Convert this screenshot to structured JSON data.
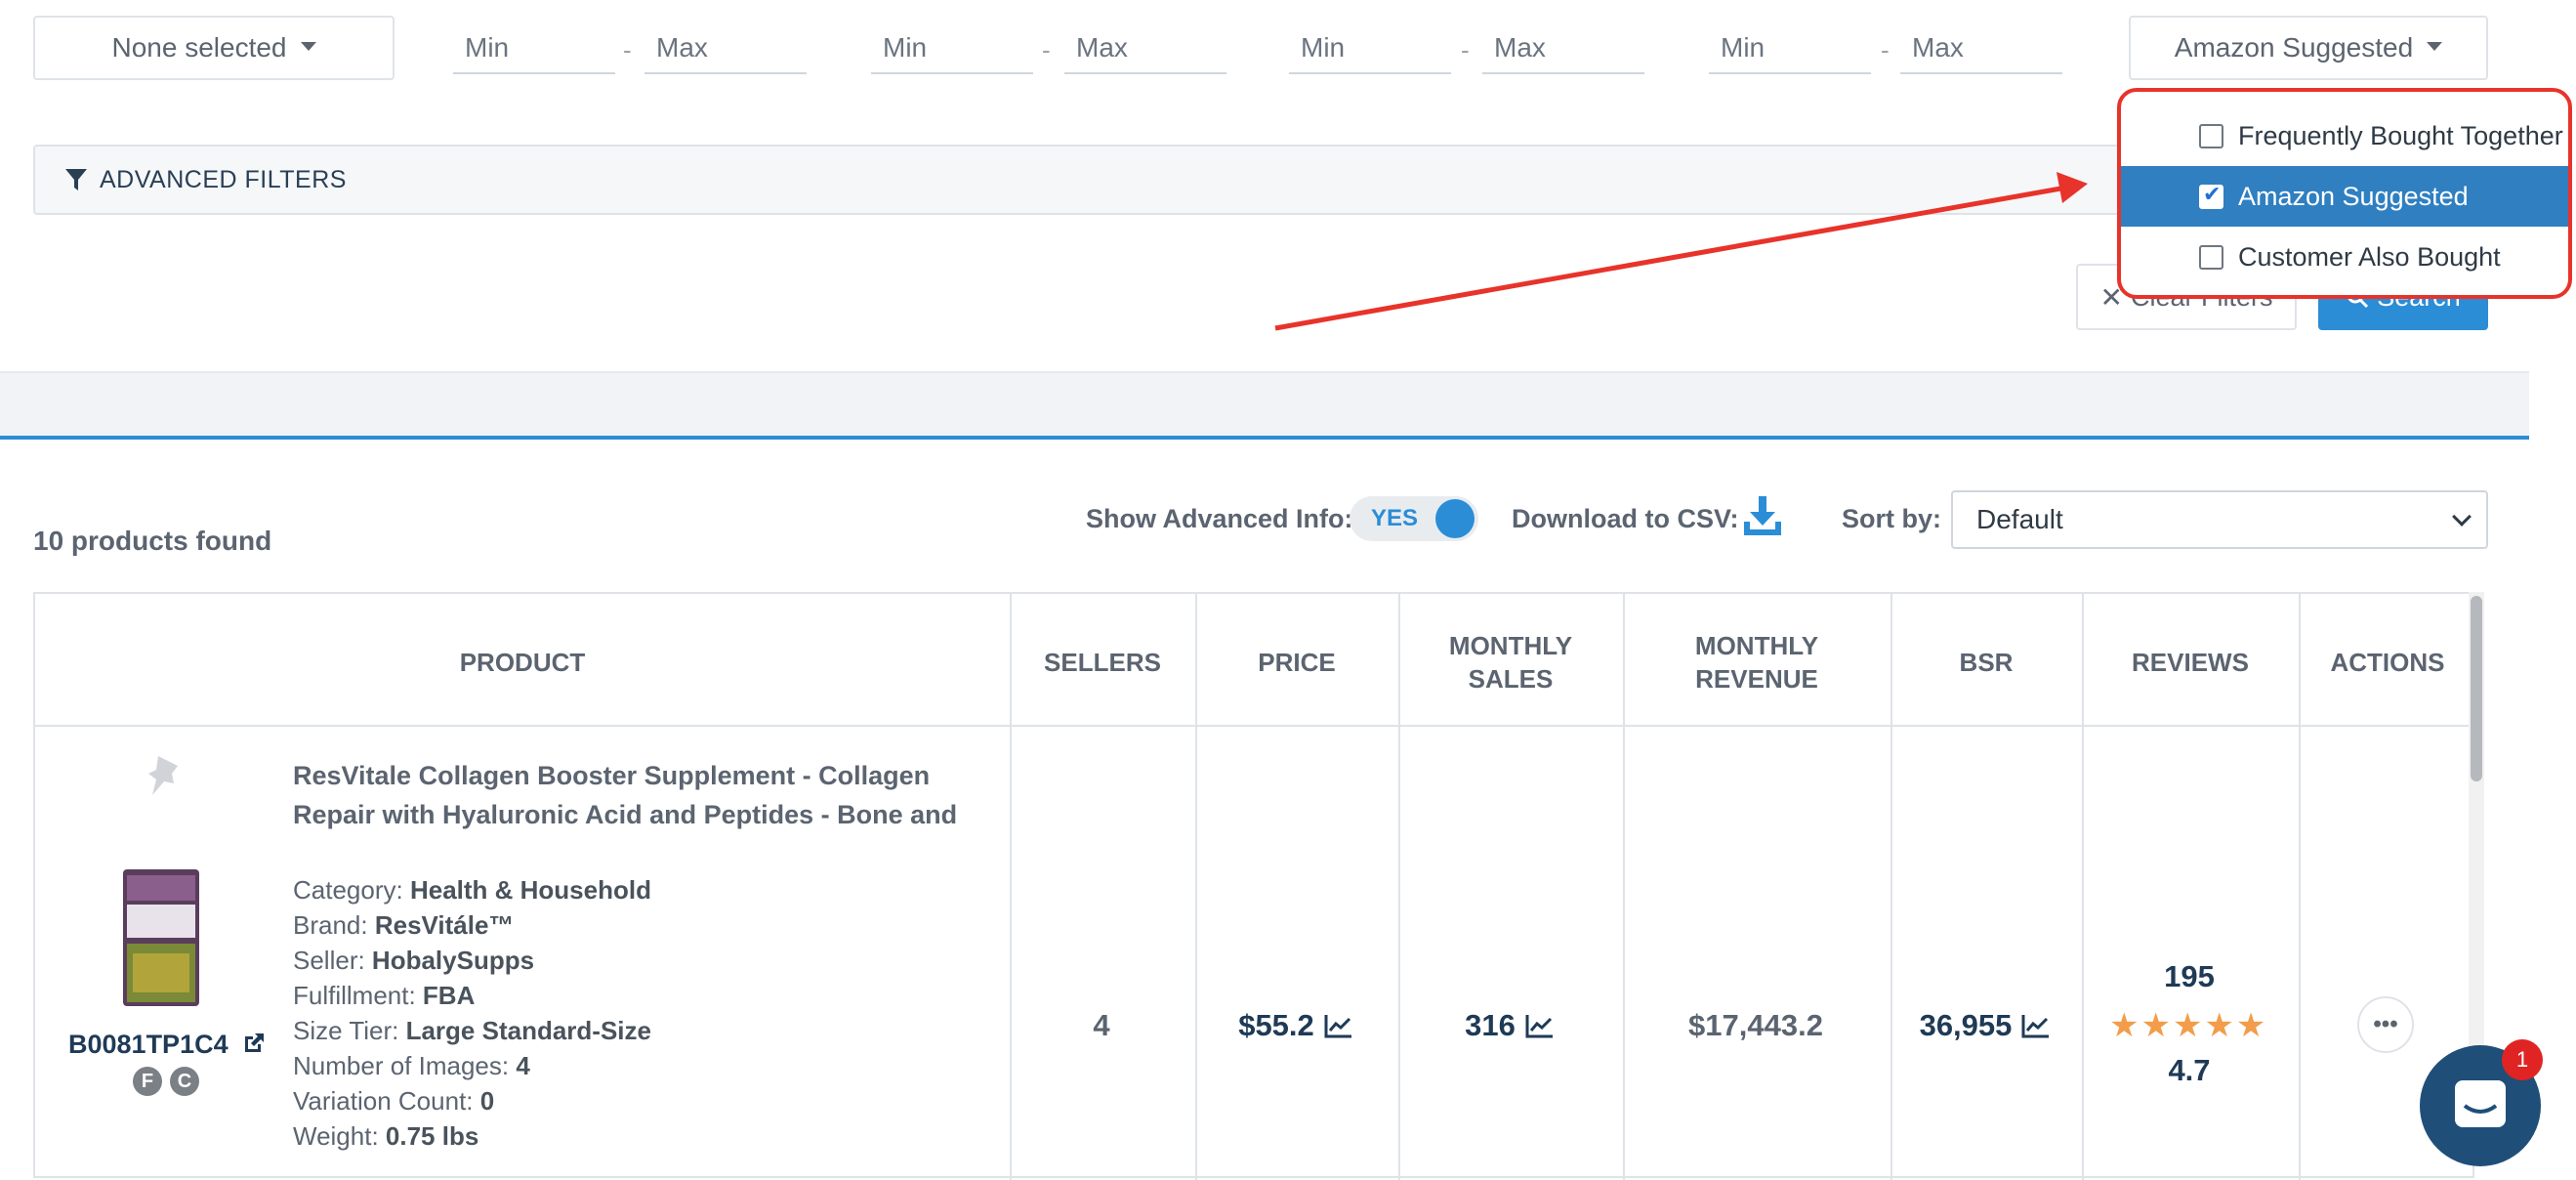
{
  "filters": {
    "none_selected": "None selected",
    "ranges": [
      {
        "min": "Min",
        "max": "Max"
      },
      {
        "min": "Min",
        "max": "Max"
      },
      {
        "min": "Min",
        "max": "Max"
      },
      {
        "min": "Min",
        "max": "Max"
      }
    ],
    "dash": "-",
    "relation_select": "Amazon Suggested",
    "advanced_filters": "ADVANCED FILTERS",
    "clear_filters": "Clear Filters",
    "search": "Search"
  },
  "dropdown": {
    "options": [
      {
        "label": "Frequently Bought Together",
        "checked": false
      },
      {
        "label": "Amazon Suggested",
        "checked": true
      },
      {
        "label": "Customer Also Bought",
        "checked": false
      }
    ]
  },
  "results": {
    "found": "10 products found",
    "show_advanced_label": "Show Advanced Info:",
    "toggle_value": "YES",
    "download_label": "Download to CSV:",
    "sort_label": "Sort by:",
    "sort_value": "Default"
  },
  "table": {
    "headers": {
      "product": "PRODUCT",
      "sellers": "SELLERS",
      "price": "PRICE",
      "monthly_sales_1": "MONTHLY",
      "monthly_sales_2": "SALES",
      "monthly_revenue_1": "MONTHLY",
      "monthly_revenue_2": "REVENUE",
      "bsr": "BSR",
      "reviews": "REVIEWS",
      "actions": "ACTIONS"
    },
    "row": {
      "title_line1": "ResVitale Collagen Booster Supplement - Collagen",
      "title_line2": "Repair with Hyaluronic Acid and Peptides - Bone and",
      "asin": "B0081TP1C4",
      "badge_f": "F",
      "badge_c": "C",
      "details": [
        {
          "label": "Category: ",
          "value": "Health & Household"
        },
        {
          "label": "Brand: ",
          "value": "ResVitále™"
        },
        {
          "label": "Seller: ",
          "value": "HobalySupps"
        },
        {
          "label": "Fulfillment: ",
          "value": "FBA"
        },
        {
          "label": "Size Tier: ",
          "value": "Large Standard-Size"
        },
        {
          "label": "Number of Images: ",
          "value": "4"
        },
        {
          "label": "Variation Count: ",
          "value": "0"
        },
        {
          "label": "Weight: ",
          "value": "0.75 lbs"
        }
      ],
      "sellers": "4",
      "price": "$55.2",
      "monthly_sales": "316",
      "monthly_revenue": "$17,443.2",
      "bsr": "36,955",
      "review_count": "195",
      "rating": "4.7",
      "rating_stars": "★★★★★"
    }
  },
  "chat": {
    "badge": "1"
  },
  "colors": {
    "accent": "#2b8dd6",
    "annotation": "#e8332a",
    "dropdown_selected": "#2f7fc1"
  }
}
